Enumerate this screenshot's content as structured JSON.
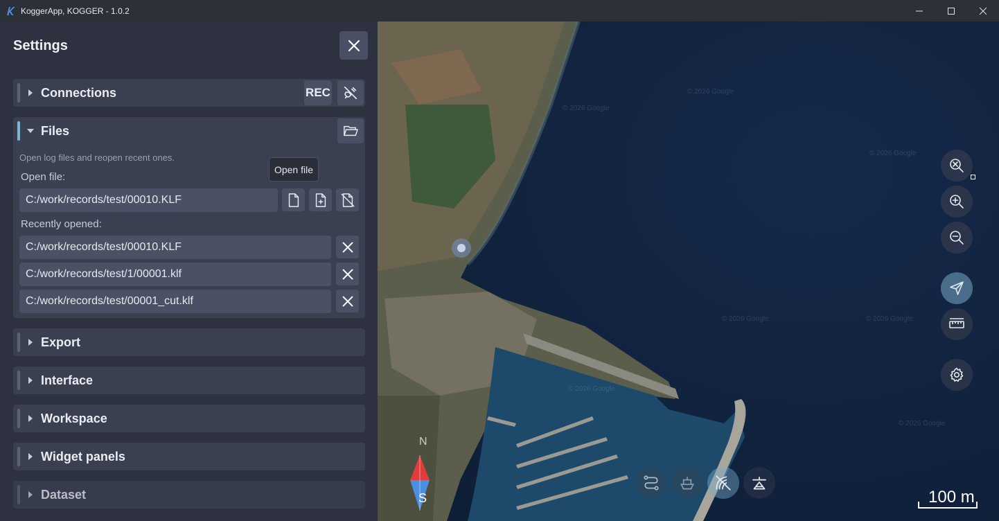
{
  "window": {
    "title": "KoggerApp, KOGGER - 1.0.2",
    "logo_icon": "kogger-logo-icon",
    "controls": [
      "minimize-icon",
      "maximize-icon",
      "close-icon"
    ]
  },
  "settings": {
    "title": "Settings",
    "sections": {
      "connections": {
        "label": "Connections",
        "rec_label": "REC"
      },
      "files": {
        "label": "Files",
        "hint": "Open log files and reopen recent ones.",
        "open_file_label": "Open file:",
        "open_file_value": "C:/work/records/test/00010.KLF",
        "recent_label": "Recently opened:",
        "recent": [
          "C:/work/records/test/00010.KLF",
          "C:/work/records/test/1/00001.klf",
          "C:/work/records/test/00001_cut.klf"
        ],
        "tooltip": "Open file"
      },
      "export": {
        "label": "Export"
      },
      "interface": {
        "label": "Interface"
      },
      "workspace": {
        "label": "Workspace"
      },
      "widget_panels": {
        "label": "Widget panels"
      },
      "dataset": {
        "label": "Dataset"
      }
    }
  },
  "map": {
    "scale_label": "100 m",
    "watermark": "© 2026 Google",
    "compass_south": "S",
    "compass_north": "N",
    "side_buttons": [
      "zoom-reset-icon",
      "zoom-in-icon",
      "zoom-out-icon",
      "navigate-icon",
      "ruler-icon",
      "gear-icon"
    ],
    "bottom_buttons": [
      "track-icon",
      "boat-icon",
      "sonar-icon",
      "surface-icon"
    ]
  }
}
